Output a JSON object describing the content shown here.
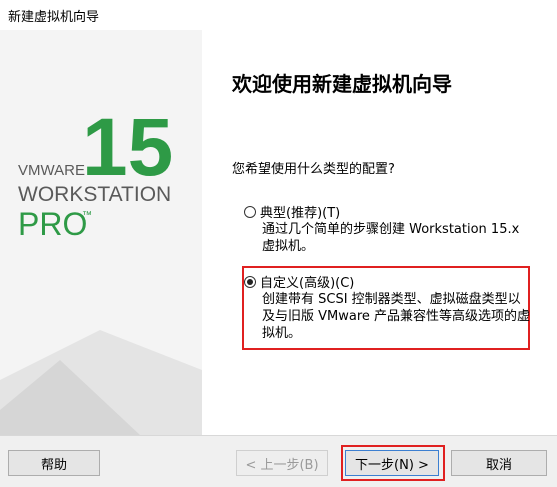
{
  "window": {
    "title": "新建虚拟机向导"
  },
  "brand": {
    "version": "15",
    "vendor": "VMWARE",
    "product": "WORKSTATION",
    "edition": "PRO",
    "trademark": "™",
    "accent_color": "#2e9a46",
    "dark_color": "#5a5a5a"
  },
  "page": {
    "heading": "欢迎使用新建虚拟机向导",
    "question": "您希望使用什么类型的配置?",
    "options": [
      {
        "label": "典型(推荐)(T)",
        "description": "通过几个简单的步骤创建 Workstation 15.x 虚拟机。",
        "selected": false
      },
      {
        "label": "自定义(高级)(C)",
        "description": "创建带有 SCSI 控制器类型、虚拟磁盘类型以及与旧版 VMware 产品兼容性等高级选项的虚拟机。",
        "selected": true
      }
    ]
  },
  "buttons": {
    "help": "帮助",
    "back": "< 上一步(B)",
    "next": "下一步(N) >",
    "cancel": "取消"
  },
  "highlight_color": "#e02020"
}
